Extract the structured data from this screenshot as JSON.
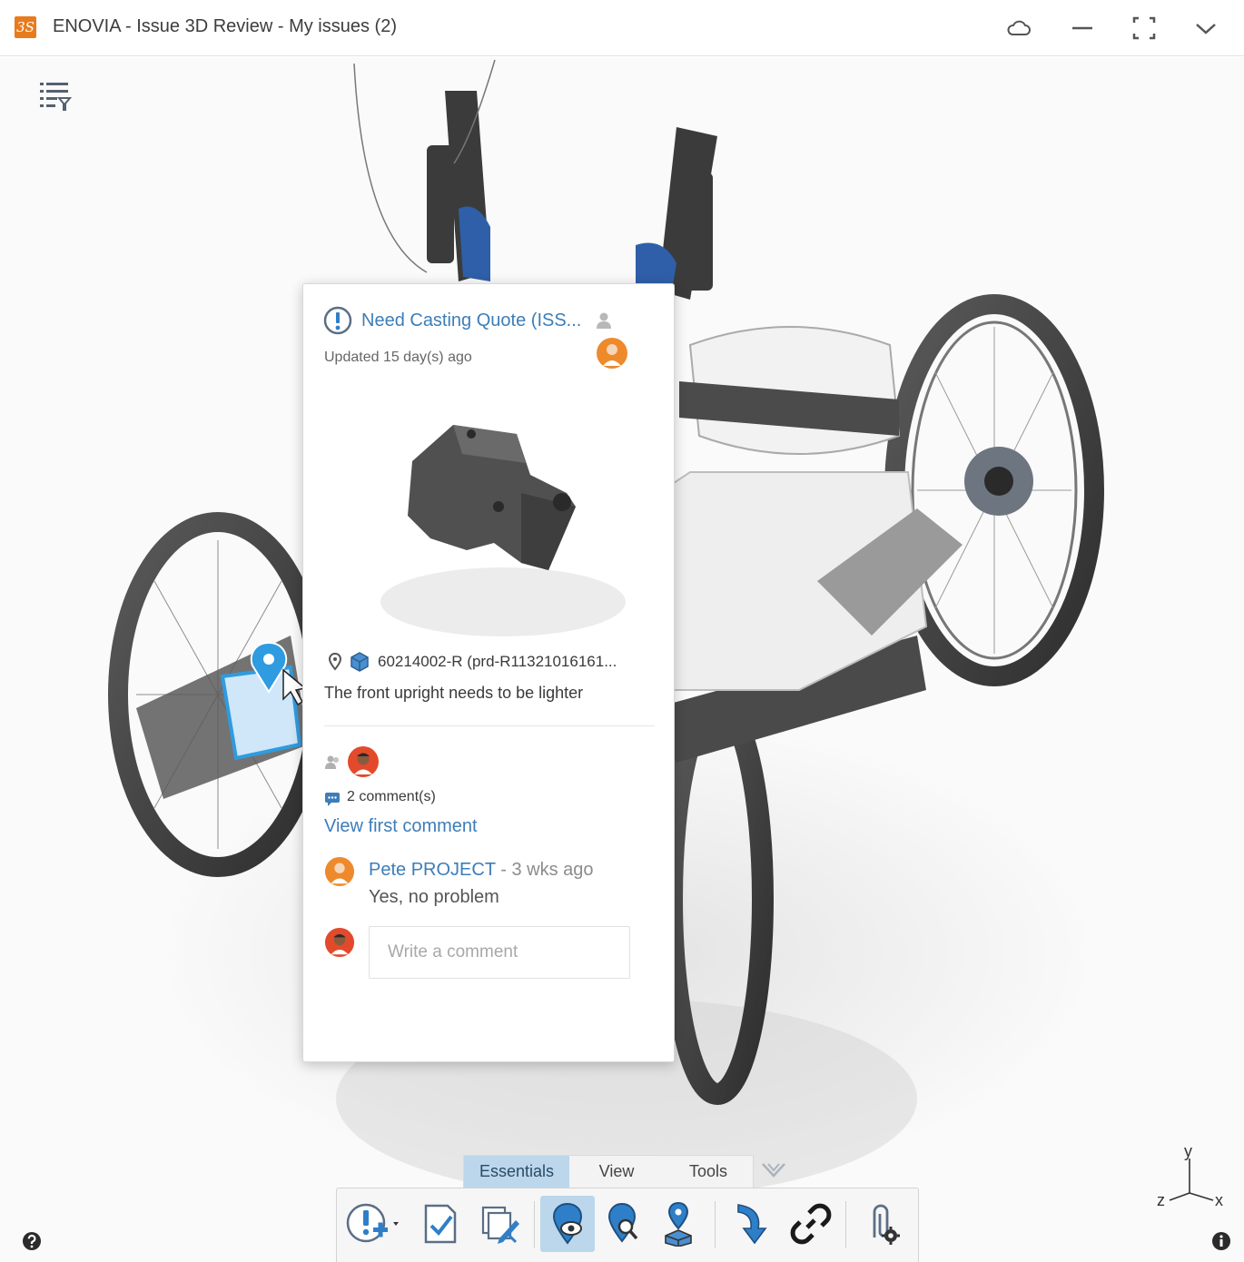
{
  "window": {
    "logo_glyph": "3S",
    "title": "ENOVIA - Issue 3D Review - My issues (2)"
  },
  "issue_card": {
    "title": "Need Casting Quote (ISS...",
    "updated": "Updated 15 day(s) ago",
    "product_ref": "60214002-R (prd-R11321016161...",
    "description": "The front upright needs to be lighter",
    "comment_count": "2 comment(s)",
    "view_first_comment": "View first comment",
    "comment": {
      "author": "Pete PROJECT",
      "separator": " - ",
      "time": "3 wks ago",
      "text": "Yes, no problem"
    },
    "comment_placeholder": "Write a comment"
  },
  "action_bar": {
    "tabs": [
      {
        "label": "Essentials",
        "active": true
      },
      {
        "label": "View",
        "active": false
      },
      {
        "label": "Tools",
        "active": false
      }
    ]
  },
  "compass": {
    "y": "y",
    "x": "x",
    "z": "z"
  },
  "colors": {
    "accent": "#3d7db8",
    "brand": "#e87b1e",
    "tab_active": "#bcd7ec",
    "issue_pin": "#2f9be0"
  },
  "icons": [
    "app-logo-icon",
    "cloud-icon",
    "minimize-icon",
    "fullscreen-icon",
    "chevron-down-icon",
    "filter-list-icon",
    "issue-icon",
    "owner-person-icon",
    "pin-icon",
    "product-icon",
    "assignees-icon",
    "comment-icon",
    "help-icon",
    "info-icon"
  ]
}
